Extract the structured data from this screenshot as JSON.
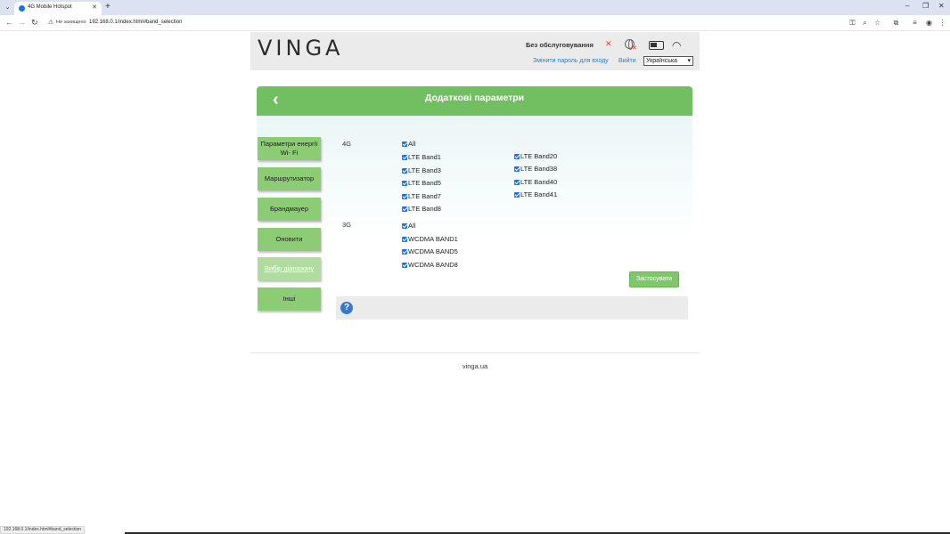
{
  "browser": {
    "tab_title": "4G Mobile Hotspot",
    "tab_close": "✕",
    "new_tab": "+",
    "not_secure_label": "Не захищено",
    "url": "192.168.0.1/index.html#band_selection",
    "status_url": "192.168.0.1/index.html#band_selection"
  },
  "header": {
    "logo": "VINGA",
    "network_status": "Без обслуговування",
    "change_password_link": "Змінити пароль для входу",
    "logout_link": "Вийти",
    "language_selected": "Українська"
  },
  "page": {
    "title": "Додаткові параметри"
  },
  "sidebar": {
    "items": [
      {
        "label": "Параметри енергії Wi- Fi",
        "active": false
      },
      {
        "label": "Маршрутизатор",
        "active": false
      },
      {
        "label": "Брандмауер",
        "active": false
      },
      {
        "label": "Оновити",
        "active": false
      },
      {
        "label": "Вибір діапазону",
        "active": true
      },
      {
        "label": "Інші",
        "active": false
      }
    ]
  },
  "bands": {
    "lte": {
      "label": "4G",
      "all_label": "All",
      "col1": [
        "LTE Band1",
        "LTE Band3",
        "LTE Band5",
        "LTE Band7",
        "LTE Band8"
      ],
      "col2": [
        "LTE Band20",
        "LTE Band38",
        "LTE Band40",
        "LTE Band41"
      ]
    },
    "wcdma": {
      "label": "3G",
      "all_label": "All",
      "items": [
        "WCDMA BAND1",
        "WCDMA BAND5",
        "WCDMA BAND8"
      ]
    }
  },
  "apply_button": "Застосувати",
  "help_icon_label": "?",
  "footer": "vinga.ua",
  "colors": {
    "accent_green": "#72bf62",
    "button_green": "#8ccc74",
    "link_blue": "#2a7fcc",
    "checkbox_blue": "#1a73e8"
  }
}
